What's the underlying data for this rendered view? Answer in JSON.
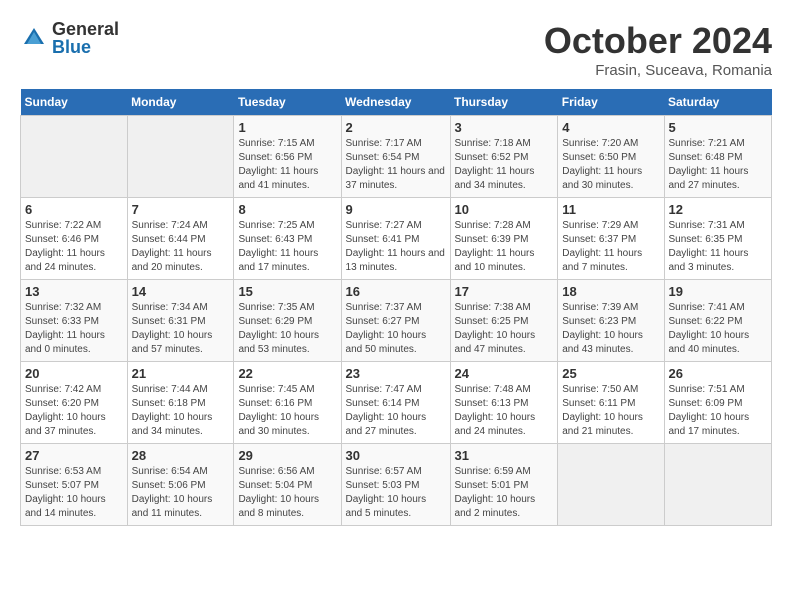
{
  "logo": {
    "general": "General",
    "blue": "Blue"
  },
  "title": "October 2024",
  "location": "Frasin, Suceava, Romania",
  "headers": [
    "Sunday",
    "Monday",
    "Tuesday",
    "Wednesday",
    "Thursday",
    "Friday",
    "Saturday"
  ],
  "weeks": [
    [
      {
        "day": "",
        "info": ""
      },
      {
        "day": "",
        "info": ""
      },
      {
        "day": "1",
        "info": "Sunrise: 7:15 AM\nSunset: 6:56 PM\nDaylight: 11 hours and 41 minutes."
      },
      {
        "day": "2",
        "info": "Sunrise: 7:17 AM\nSunset: 6:54 PM\nDaylight: 11 hours and 37 minutes."
      },
      {
        "day": "3",
        "info": "Sunrise: 7:18 AM\nSunset: 6:52 PM\nDaylight: 11 hours and 34 minutes."
      },
      {
        "day": "4",
        "info": "Sunrise: 7:20 AM\nSunset: 6:50 PM\nDaylight: 11 hours and 30 minutes."
      },
      {
        "day": "5",
        "info": "Sunrise: 7:21 AM\nSunset: 6:48 PM\nDaylight: 11 hours and 27 minutes."
      }
    ],
    [
      {
        "day": "6",
        "info": "Sunrise: 7:22 AM\nSunset: 6:46 PM\nDaylight: 11 hours and 24 minutes."
      },
      {
        "day": "7",
        "info": "Sunrise: 7:24 AM\nSunset: 6:44 PM\nDaylight: 11 hours and 20 minutes."
      },
      {
        "day": "8",
        "info": "Sunrise: 7:25 AM\nSunset: 6:43 PM\nDaylight: 11 hours and 17 minutes."
      },
      {
        "day": "9",
        "info": "Sunrise: 7:27 AM\nSunset: 6:41 PM\nDaylight: 11 hours and 13 minutes."
      },
      {
        "day": "10",
        "info": "Sunrise: 7:28 AM\nSunset: 6:39 PM\nDaylight: 11 hours and 10 minutes."
      },
      {
        "day": "11",
        "info": "Sunrise: 7:29 AM\nSunset: 6:37 PM\nDaylight: 11 hours and 7 minutes."
      },
      {
        "day": "12",
        "info": "Sunrise: 7:31 AM\nSunset: 6:35 PM\nDaylight: 11 hours and 3 minutes."
      }
    ],
    [
      {
        "day": "13",
        "info": "Sunrise: 7:32 AM\nSunset: 6:33 PM\nDaylight: 11 hours and 0 minutes."
      },
      {
        "day": "14",
        "info": "Sunrise: 7:34 AM\nSunset: 6:31 PM\nDaylight: 10 hours and 57 minutes."
      },
      {
        "day": "15",
        "info": "Sunrise: 7:35 AM\nSunset: 6:29 PM\nDaylight: 10 hours and 53 minutes."
      },
      {
        "day": "16",
        "info": "Sunrise: 7:37 AM\nSunset: 6:27 PM\nDaylight: 10 hours and 50 minutes."
      },
      {
        "day": "17",
        "info": "Sunrise: 7:38 AM\nSunset: 6:25 PM\nDaylight: 10 hours and 47 minutes."
      },
      {
        "day": "18",
        "info": "Sunrise: 7:39 AM\nSunset: 6:23 PM\nDaylight: 10 hours and 43 minutes."
      },
      {
        "day": "19",
        "info": "Sunrise: 7:41 AM\nSunset: 6:22 PM\nDaylight: 10 hours and 40 minutes."
      }
    ],
    [
      {
        "day": "20",
        "info": "Sunrise: 7:42 AM\nSunset: 6:20 PM\nDaylight: 10 hours and 37 minutes."
      },
      {
        "day": "21",
        "info": "Sunrise: 7:44 AM\nSunset: 6:18 PM\nDaylight: 10 hours and 34 minutes."
      },
      {
        "day": "22",
        "info": "Sunrise: 7:45 AM\nSunset: 6:16 PM\nDaylight: 10 hours and 30 minutes."
      },
      {
        "day": "23",
        "info": "Sunrise: 7:47 AM\nSunset: 6:14 PM\nDaylight: 10 hours and 27 minutes."
      },
      {
        "day": "24",
        "info": "Sunrise: 7:48 AM\nSunset: 6:13 PM\nDaylight: 10 hours and 24 minutes."
      },
      {
        "day": "25",
        "info": "Sunrise: 7:50 AM\nSunset: 6:11 PM\nDaylight: 10 hours and 21 minutes."
      },
      {
        "day": "26",
        "info": "Sunrise: 7:51 AM\nSunset: 6:09 PM\nDaylight: 10 hours and 17 minutes."
      }
    ],
    [
      {
        "day": "27",
        "info": "Sunrise: 6:53 AM\nSunset: 5:07 PM\nDaylight: 10 hours and 14 minutes."
      },
      {
        "day": "28",
        "info": "Sunrise: 6:54 AM\nSunset: 5:06 PM\nDaylight: 10 hours and 11 minutes."
      },
      {
        "day": "29",
        "info": "Sunrise: 6:56 AM\nSunset: 5:04 PM\nDaylight: 10 hours and 8 minutes."
      },
      {
        "day": "30",
        "info": "Sunrise: 6:57 AM\nSunset: 5:03 PM\nDaylight: 10 hours and 5 minutes."
      },
      {
        "day": "31",
        "info": "Sunrise: 6:59 AM\nSunset: 5:01 PM\nDaylight: 10 hours and 2 minutes."
      },
      {
        "day": "",
        "info": ""
      },
      {
        "day": "",
        "info": ""
      }
    ]
  ]
}
